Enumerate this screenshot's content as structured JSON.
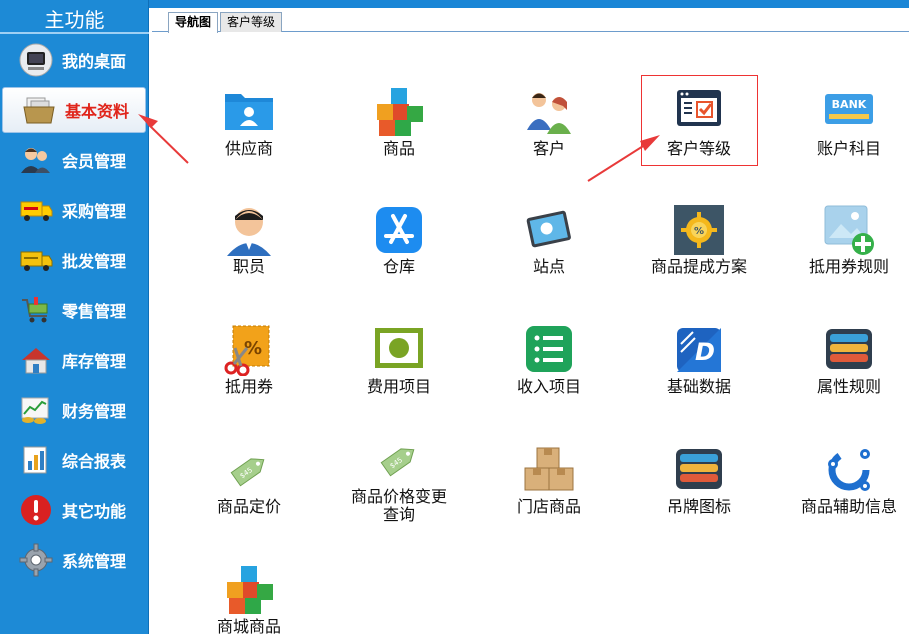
{
  "sidebar": {
    "title": "主功能",
    "items": [
      {
        "label": "我的桌面",
        "icon": "monitor-icon"
      },
      {
        "label": "基本资料",
        "icon": "folder-files-icon",
        "active": true
      },
      {
        "label": "会员管理",
        "icon": "members-icon"
      },
      {
        "label": "采购管理",
        "icon": "dhl-truck-icon"
      },
      {
        "label": "批发管理",
        "icon": "delivery-truck-icon"
      },
      {
        "label": "零售管理",
        "icon": "shopping-cart-icon"
      },
      {
        "label": "库存管理",
        "icon": "house-icon"
      },
      {
        "label": "财务管理",
        "icon": "finance-chart-icon"
      },
      {
        "label": "综合报表",
        "icon": "bar-report-icon"
      },
      {
        "label": "其它功能",
        "icon": "exclamation-icon"
      },
      {
        "label": "系统管理",
        "icon": "gear-icon"
      }
    ]
  },
  "tabs": [
    {
      "label": "导航图",
      "active": true
    },
    {
      "label": "客户等级",
      "active": false
    }
  ],
  "grid": [
    {
      "label": "供应商",
      "icon": "folder-user-icon"
    },
    {
      "label": "商品",
      "icon": "color-cubes-icon"
    },
    {
      "label": "客户",
      "icon": "customers-icon"
    },
    {
      "label": "客户等级",
      "icon": "checklist-window-icon",
      "highlighted": true
    },
    {
      "label": "账户科目",
      "icon": "bank-card-icon"
    },
    {
      "label": "职员",
      "icon": "employee-icon"
    },
    {
      "label": "仓库",
      "icon": "app-store-icon"
    },
    {
      "label": "站点",
      "icon": "tablet-icon"
    },
    {
      "label": "商品提成方案",
      "icon": "badge-gear-icon"
    },
    {
      "label": "抵用券规则",
      "icon": "image-plus-icon"
    },
    {
      "label": "抵用券",
      "icon": "coupon-scissors-icon"
    },
    {
      "label": "费用项目",
      "icon": "green-frame-icon"
    },
    {
      "label": "收入项目",
      "icon": "green-list-icon"
    },
    {
      "label": "基础数据",
      "icon": "d-logo-icon"
    },
    {
      "label": "属性规则",
      "icon": "stacked-layers-icon"
    },
    {
      "label": "商品定价",
      "icon": "price-tag-icon"
    },
    {
      "label": "商品价格变更查询",
      "icon": "price-tag-icon"
    },
    {
      "label": "门店商品",
      "icon": "boxes-icon"
    },
    {
      "label": "吊牌图标",
      "icon": "stacked-layers-icon"
    },
    {
      "label": "商品辅助信息",
      "icon": "gear-ring-icon"
    },
    {
      "label": "商城商品",
      "icon": "color-cubes-icon"
    }
  ],
  "colors": {
    "sidebar_bg": "#1d8ad6",
    "active_label": "#e0251b",
    "highlight_border": "#ee3333",
    "arrow": "#e83a3a"
  }
}
